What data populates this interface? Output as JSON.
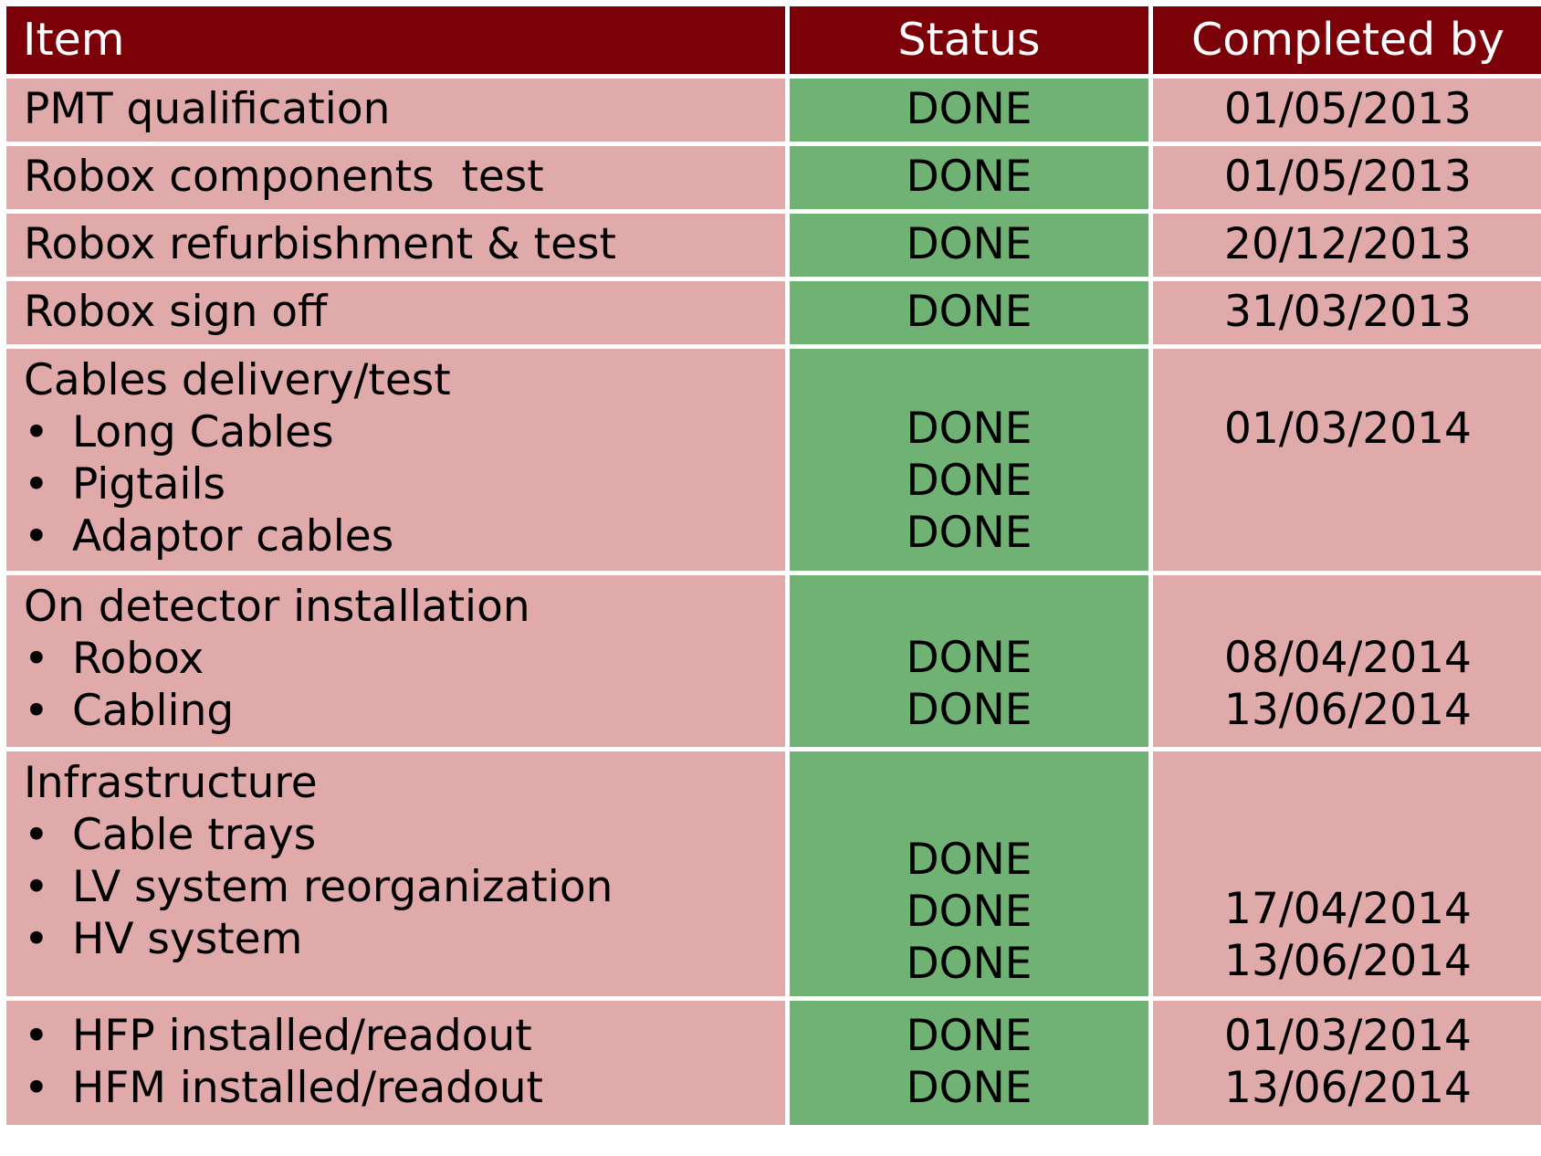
{
  "header": {
    "item": "Item",
    "status": "Status",
    "completed_by": "Completed by"
  },
  "rows": [
    {
      "title": "PMT qualification",
      "status": [
        "DONE"
      ],
      "dates": [
        "01/05/2013"
      ]
    },
    {
      "title": "Robox components  test",
      "status": [
        "DONE"
      ],
      "dates": [
        "01/05/2013"
      ]
    },
    {
      "title": "Robox refurbishment & test",
      "status": [
        "DONE"
      ],
      "dates": [
        "20/12/2013"
      ]
    },
    {
      "title": "Robox sign off",
      "status": [
        "DONE"
      ],
      "dates": [
        "31/03/2013"
      ]
    },
    {
      "title": "Cables delivery/test",
      "bullets": [
        "Long Cables",
        "Pigtails",
        "Adaptor cables"
      ],
      "status": [
        "DONE",
        "DONE",
        "DONE"
      ],
      "dates": [
        "01/03/2014"
      ]
    },
    {
      "title": "On detector installation",
      "bullets": [
        "Robox",
        "Cabling"
      ],
      "status": [
        "DONE",
        "DONE"
      ],
      "dates": [
        "08/04/2014",
        "13/06/2014"
      ]
    },
    {
      "title": "Infrastructure",
      "bullets": [
        "Cable trays",
        "LV system reorganization",
        "HV system"
      ],
      "status": [
        "DONE",
        "DONE",
        "DONE"
      ],
      "dates": [
        "17/04/2014",
        "13/06/2014"
      ]
    },
    {
      "bullets": [
        "HFP installed/readout",
        "HFM installed/readout"
      ],
      "status": [
        "DONE",
        "DONE"
      ],
      "dates": [
        "01/03/2014",
        "13/06/2014"
      ]
    }
  ]
}
